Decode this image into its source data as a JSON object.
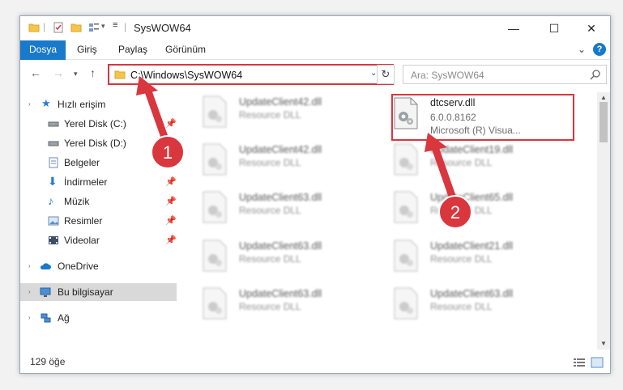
{
  "window": {
    "title": "SysWOW64",
    "controls": {
      "minimize": "—",
      "maximize": "☐",
      "close": "✕"
    }
  },
  "ribbon": {
    "tabs": [
      "Dosya",
      "Giriş",
      "Paylaş",
      "Görünüm"
    ],
    "help": "?"
  },
  "address_bar": {
    "path": "C:\\Windows\\SysWOW64",
    "refresh": "↻"
  },
  "search": {
    "placeholder": "Ara: SysWOW64"
  },
  "sidebar": {
    "items": [
      {
        "label": "Hızlı erişim",
        "icon": "star-icon",
        "pinned": false
      },
      {
        "label": "Yerel Disk (C:)",
        "icon": "drive-icon",
        "pinned": true
      },
      {
        "label": "Yerel Disk (D:)",
        "icon": "drive-icon",
        "pinned": false
      },
      {
        "label": "Belgeler",
        "icon": "documents-icon",
        "pinned": true
      },
      {
        "label": "İndirmeler",
        "icon": "download-icon",
        "pinned": true
      },
      {
        "label": "Müzik",
        "icon": "music-icon",
        "pinned": true
      },
      {
        "label": "Resimler",
        "icon": "pictures-icon",
        "pinned": true
      },
      {
        "label": "Videolar",
        "icon": "videos-icon",
        "pinned": true
      },
      {
        "label": "OneDrive",
        "icon": "cloud-icon",
        "pinned": false
      },
      {
        "label": "Bu bilgisayar",
        "icon": "computer-icon",
        "pinned": false,
        "selected": true
      },
      {
        "label": "Ağ",
        "icon": "network-icon",
        "pinned": false
      }
    ]
  },
  "files": {
    "left": [
      {
        "name": "UpdateClient42.dll",
        "type": "Resource DLL"
      },
      {
        "name": "UpdateClient42.dll",
        "type": "Resource DLL"
      },
      {
        "name": "UpdateClient63.dll",
        "type": "Resource DLL"
      },
      {
        "name": "UpdateClient63.dll",
        "type": "Resource DLL"
      },
      {
        "name": "UpdateClient63.dll",
        "type": "Resource DLL"
      }
    ],
    "right": [
      {
        "name": "dtcserv.dll",
        "version": "6.0.0.8162",
        "company": "Microsoft (R) Visua..."
      },
      {
        "name": "UpdateClient19.dll",
        "type": "Resource DLL"
      },
      {
        "name": "UpdateClient65.dll",
        "type": "Resource DLL"
      },
      {
        "name": "UpdateClient21.dll",
        "type": "Resource DLL"
      },
      {
        "name": "UpdateClient63.dll",
        "type": "Resource DLL"
      }
    ]
  },
  "status": {
    "item_count": "129 öğe"
  },
  "annotations": {
    "step1": "1",
    "step2": "2",
    "color": "#d9363e"
  }
}
